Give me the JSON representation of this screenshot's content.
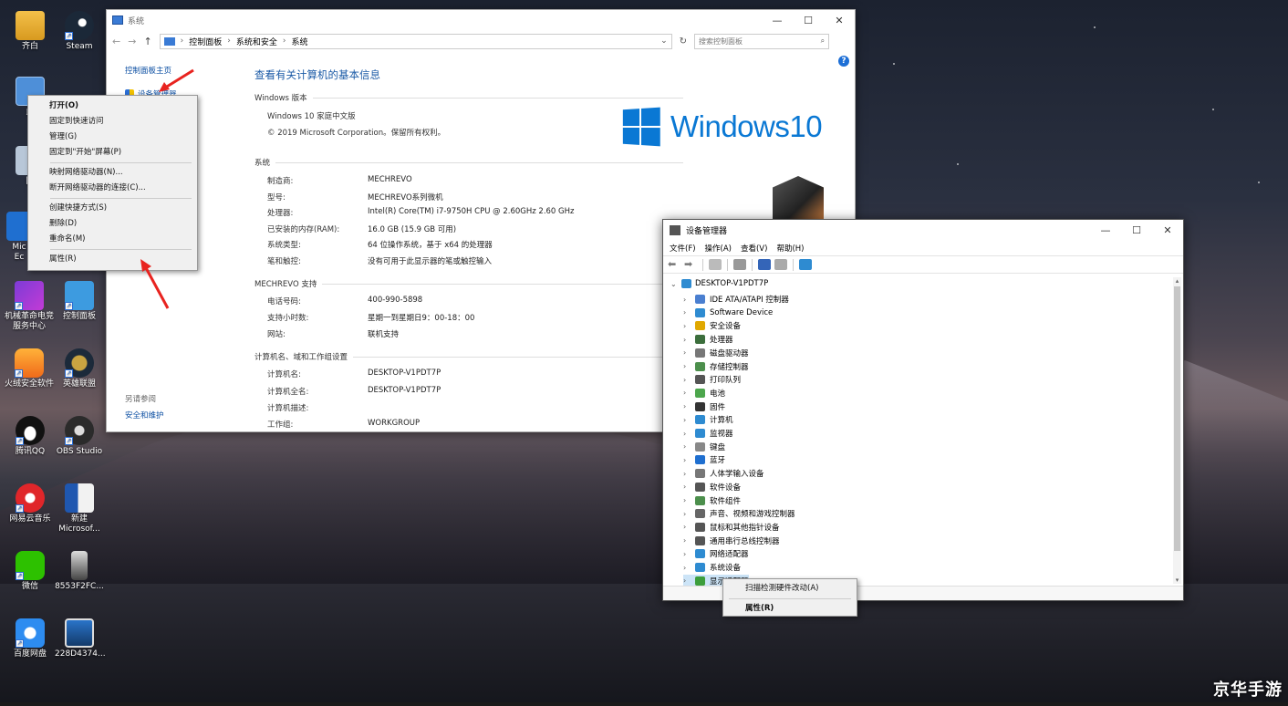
{
  "desktop": {
    "icons": [
      {
        "label": "齐白"
      },
      {
        "label": "Steam"
      },
      {
        "label": "此"
      },
      {
        "label": "回"
      },
      {
        "label": "Mic"
      },
      {
        "label": "Ec"
      },
      {
        "label": "机械革命电竞"
      },
      {
        "label": "服务中心"
      },
      {
        "label": "控制面板"
      },
      {
        "label": "火绒安全软件"
      },
      {
        "label": "英雄联盟"
      },
      {
        "label": "腾讯QQ"
      },
      {
        "label": "OBS Studio"
      },
      {
        "label": "网易云音乐"
      },
      {
        "label": "新建"
      },
      {
        "label": "Microsof..."
      },
      {
        "label": "微信"
      },
      {
        "label": "8553F2FC..."
      },
      {
        "label": "百度网盘"
      },
      {
        "label": "228D4374..."
      }
    ],
    "watermark": "京华手游"
  },
  "system_window": {
    "title": "系统",
    "address": {
      "c1": "控制面板",
      "c2": "系统和安全",
      "c3": "系统"
    },
    "search_placeholder": "搜索控制面板",
    "left": {
      "home": "控制面板主页",
      "device_manager": "设备管理器",
      "see_also": "另请参阅",
      "security": "安全和维护"
    },
    "main_title": "查看有关计算机的基本信息",
    "windows_edition": {
      "heading": "Windows 版本",
      "edition": "Windows 10 家庭中文版",
      "copyright": "© 2019 Microsoft Corporation。保留所有权利。",
      "logo_text": "Windows10"
    },
    "system": {
      "heading": "系统",
      "rows": [
        {
          "label": "制造商:",
          "value": "MECHREVO"
        },
        {
          "label": "型号:",
          "value": "MECHREVO系列微机"
        },
        {
          "label": "处理器:",
          "value": "Intel(R) Core(TM) i7-9750H CPU @ 2.60GHz   2.60 GHz"
        },
        {
          "label": "已安装的内存(RAM):",
          "value": "16.0 GB (15.9 GB 可用)"
        },
        {
          "label": "系统类型:",
          "value": "64 位操作系统，基于 x64 的处理器"
        },
        {
          "label": "笔和触控:",
          "value": "没有可用于此显示器的笔或触控输入"
        }
      ]
    },
    "support": {
      "heading": "MECHREVO 支持",
      "rows": [
        {
          "label": "电话号码:",
          "value": "400-990-5898"
        },
        {
          "label": "支持小时数:",
          "value": "星期一到星期日9：00-18：00"
        },
        {
          "label": "网站:",
          "value": "联机支持"
        }
      ]
    },
    "computer": {
      "heading": "计算机名、域和工作组设置",
      "rows": [
        {
          "label": "计算机名:",
          "value": "DESKTOP-V1PDT7P"
        },
        {
          "label": "计算机全名:",
          "value": "DESKTOP-V1PDT7P"
        },
        {
          "label": "计算机描述:",
          "value": ""
        },
        {
          "label": "工作组:",
          "value": "WORKGROUP"
        }
      ]
    }
  },
  "context_menu": {
    "items": [
      "打开(O)",
      "固定到快速访问",
      "管理(G)",
      "固定到\"开始\"屏幕(P)",
      "映射网络驱动器(N)...",
      "断开网络驱动器的连接(C)...",
      "创建快捷方式(S)",
      "删除(D)",
      "重命名(M)",
      "属性(R)"
    ]
  },
  "device_manager": {
    "title": "设备管理器",
    "menu": [
      "文件(F)",
      "操作(A)",
      "查看(V)",
      "帮助(H)"
    ],
    "root": "DESKTOP-V1PDT7P",
    "nodes": [
      {
        "label": "IDE ATA/ATAPI 控制器",
        "color": "#4a7fd0"
      },
      {
        "label": "Software Device",
        "color": "#2e8bd1"
      },
      {
        "label": "安全设备",
        "color": "#e0a800"
      },
      {
        "label": "处理器",
        "color": "#3c6e3c"
      },
      {
        "label": "磁盘驱动器",
        "color": "#777777"
      },
      {
        "label": "存储控制器",
        "color": "#4c8f4c"
      },
      {
        "label": "打印队列",
        "color": "#555555"
      },
      {
        "label": "电池",
        "color": "#4ca64c"
      },
      {
        "label": "固件",
        "color": "#333333"
      },
      {
        "label": "计算机",
        "color": "#2e8bd1"
      },
      {
        "label": "监视器",
        "color": "#2e8bd1"
      },
      {
        "label": "键盘",
        "color": "#888888"
      },
      {
        "label": "蓝牙",
        "color": "#1f6fd0"
      },
      {
        "label": "人体学输入设备",
        "color": "#777777"
      },
      {
        "label": "软件设备",
        "color": "#555555"
      },
      {
        "label": "软件组件",
        "color": "#4c8f4c"
      },
      {
        "label": "声音、视频和游戏控制器",
        "color": "#666666"
      },
      {
        "label": "鼠标和其他指针设备",
        "color": "#555555"
      },
      {
        "label": "通用串行总线控制器",
        "color": "#555555"
      },
      {
        "label": "网络适配器",
        "color": "#2e8bd1"
      },
      {
        "label": "系统设备",
        "color": "#2e8bd1"
      },
      {
        "label": "显示适配器",
        "color": "#3c9e3c"
      }
    ],
    "context": {
      "scan": "扫描检测硬件改动(A)",
      "properties": "属性(R)"
    }
  }
}
